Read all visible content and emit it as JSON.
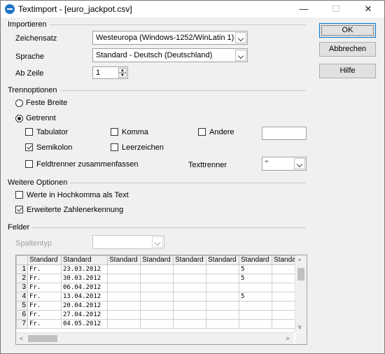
{
  "window": {
    "title": "Textimport - [euro_jackpot.csv]",
    "minimize_glyph": "—",
    "maximize_glyph": "☐",
    "close_glyph": "✕"
  },
  "import": {
    "section_label": "Importieren",
    "charset_label": "Zeichensatz",
    "charset_value": "Westeuropa (Windows-1252/WinLatin 1)",
    "language_label": "Sprache",
    "language_value": "Standard - Deutsch (Deutschland)",
    "from_row_label": "Ab Zeile",
    "from_row_value": "1"
  },
  "buttons": {
    "ok": "OK",
    "cancel": "Abbrechen",
    "help": "Hilfe"
  },
  "separator": {
    "section_label": "Trennoptionen",
    "fixed_width": "Feste Breite",
    "separated": "Getrennt",
    "tab": "Tabulator",
    "comma": "Komma",
    "other": "Andere",
    "semicolon": "Semikolon",
    "space": "Leerzeichen",
    "merge": "Feldtrenner zusammenfassen",
    "text_delimiter_label": "Texttrenner",
    "text_delimiter_value": "\"",
    "state": {
      "fixed_width": false,
      "separated": true,
      "tab": false,
      "comma": false,
      "other": false,
      "semicolon": true,
      "space": false,
      "merge": false
    }
  },
  "more": {
    "section_label": "Weitere Optionen",
    "quoted_as_text": "Werte in Hochkomma als Text",
    "detect_numbers": "Erweiterte Zahlenerkennung",
    "state": {
      "quoted_as_text": false,
      "detect_numbers": true
    }
  },
  "fields": {
    "section_label": "Felder",
    "column_type_label": "Spaltentyp",
    "column_type_value": ""
  },
  "grid": {
    "headers": [
      "Standard",
      "Standard",
      "Standard",
      "Standard",
      "Standard",
      "Standard",
      "Standard",
      "Standard"
    ],
    "rows": [
      {
        "n": "1",
        "c": [
          "Fr.",
          "23.03.2012",
          "",
          "",
          "",
          "",
          "5",
          ""
        ]
      },
      {
        "n": "2",
        "c": [
          "Fr.",
          "30.03.2012",
          "",
          "",
          "",
          "",
          "5",
          ""
        ]
      },
      {
        "n": "3",
        "c": [
          "Fr.",
          "06.04.2012",
          "",
          "",
          "",
          "",
          "",
          ""
        ]
      },
      {
        "n": "4",
        "c": [
          "Fr.",
          "13.04.2012",
          "",
          "",
          "",
          "",
          "5",
          ""
        ]
      },
      {
        "n": "5",
        "c": [
          "Fr.",
          "20.04.2012",
          "",
          "",
          "",
          "",
          "",
          ""
        ]
      },
      {
        "n": "6",
        "c": [
          "Fr.",
          "27.04.2012",
          "",
          "",
          "",
          "",
          "",
          ""
        ]
      },
      {
        "n": "7",
        "c": [
          "Fr.",
          "04.05.2012",
          "",
          "",
          "",
          "",
          "",
          ""
        ]
      }
    ]
  },
  "icons": {
    "up": "^",
    "down": "v",
    "left": "<",
    "right": ">",
    "spin_up": "▲",
    "spin_down": "▼"
  }
}
